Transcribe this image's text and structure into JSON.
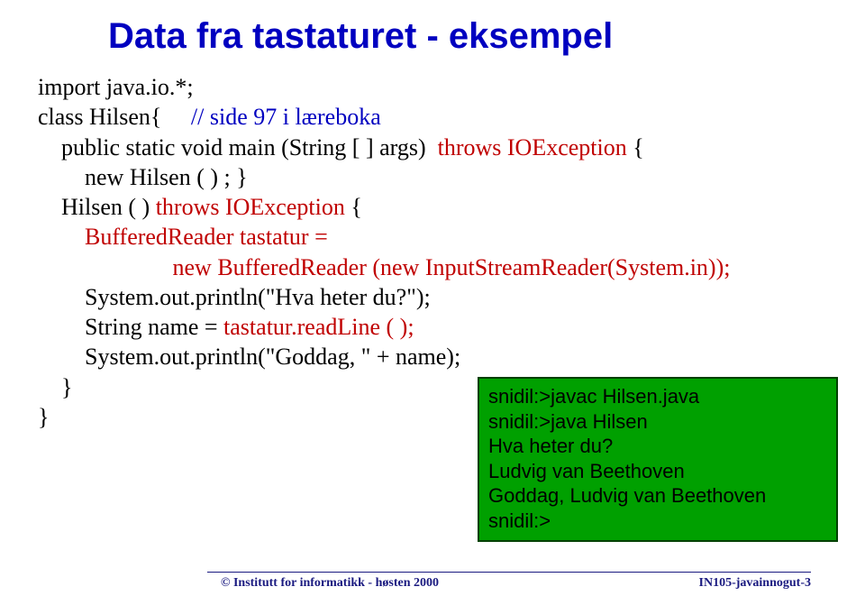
{
  "title": "Data fra tastaturet - eksempel",
  "code": {
    "l1a": "import java.io.*;",
    "l2a": "class Hilsen{     ",
    "l2b": "// side 97 i læreboka",
    "l3a": "    public static void main (String [ ] args)  ",
    "l3b": "throws IOException ",
    "l3c": "{",
    "l4a": "        new Hilsen ( ) ; }",
    "l5a": "    Hilsen ( ) ",
    "l5b": "throws IOException ",
    "l5c": "{",
    "l6a": "        ",
    "l6b": "BufferedReader tastatur =",
    "l7a": "                       ",
    "l7b": "new BufferedReader (new InputStreamReader(System.in));",
    "l8a": "        System.out.println(\"Hva heter du?\");",
    "l9a": "        String name = ",
    "l9b": "tastatur.readLine ( );",
    "l10a": "        System.out.println(\"Goddag, \" + name);",
    "l11a": "    }",
    "l12a": "}"
  },
  "terminal": {
    "l1": "snidil:>javac Hilsen.java",
    "l2": "snidil:>java Hilsen",
    "l3": "Hva heter du?",
    "l4": "Ludvig van Beethoven",
    "l5": "Goddag, Ludvig van Beethoven",
    "l6": "snidil:>"
  },
  "footer": {
    "left": "©  Institutt for informatikk -  høsten 2000",
    "right": "IN105-javainnogut-3"
  }
}
